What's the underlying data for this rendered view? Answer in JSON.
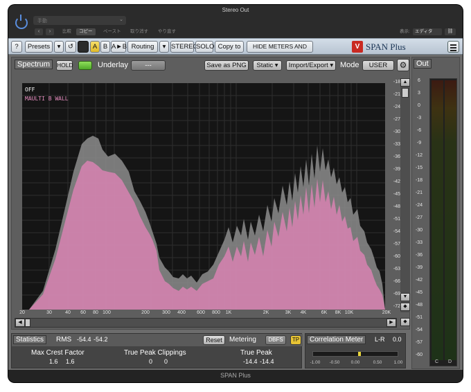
{
  "window": {
    "title": "Stereo Out",
    "footer": "SPAN Plus"
  },
  "host": {
    "preset_value": "手動",
    "buttons": [
      "比較",
      "コピー",
      "ペースト",
      "取り消す",
      "やり直す"
    ],
    "display_label": "表示:",
    "display_value": "エディタ"
  },
  "toolbar": {
    "help": "?",
    "presets": "Presets",
    "a": "A",
    "b": "B",
    "atob": "A►B",
    "routing": "Routing",
    "stereo": "STEREO",
    "solo": "SOLO",
    "copy_to": "Copy to",
    "hide_meters": "HIDE METERS AND STATS",
    "product": "SPAN Plus"
  },
  "spectrum": {
    "title": "Spectrum",
    "hold": "HOLD",
    "underlay_label": "Underlay",
    "underlay_value": "---",
    "save_png": "Save as PNG",
    "static": "Static",
    "import_export": "Import/Export",
    "mode_label": "Mode",
    "mode_value": "USER",
    "legend_off": "OFF",
    "legend_trace": "MAULTI B WALL",
    "db_ticks": [
      "-18",
      "-21",
      "-24",
      "-27",
      "-30",
      "-33",
      "-36",
      "-39",
      "-42",
      "-45",
      "-48",
      "-51",
      "-54",
      "-57",
      "-60",
      "-63",
      "-66",
      "-69",
      "-72"
    ],
    "freq_ticks": [
      "20",
      "30",
      "40",
      "60",
      "80",
      "100",
      "200",
      "300",
      "400",
      "600",
      "800",
      "1K",
      "2K",
      "3K",
      "4K",
      "6K",
      "8K",
      "10K",
      "20K"
    ]
  },
  "statistics": {
    "title": "Statistics",
    "rms_label": "RMS",
    "rms_l": "-54.4",
    "rms_r": "-54.2",
    "reset": "Reset",
    "metering_label": "Metering",
    "dbfs": "DBFS",
    "tp": "TP",
    "crest_label": "Max Crest Factor",
    "crest_l": "1.6",
    "crest_r": "1.6",
    "clip_label": "True Peak Clippings",
    "clip_l": "0",
    "clip_r": "0",
    "peak_label": "True Peak",
    "peak_l": "-14.4",
    "peak_r": "-14.4"
  },
  "correlation": {
    "title": "Correlation Meter",
    "mode": "L-R",
    "value": "0.0",
    "scale": [
      "-1.00",
      "-0.50",
      "0.00",
      "0.50",
      "1.00"
    ]
  },
  "out": {
    "title": "Out",
    "ticks": [
      "6",
      "3",
      "0",
      "-3",
      "-6",
      "-9",
      "-12",
      "-15",
      "-18",
      "-21",
      "-24",
      "-27",
      "-30",
      "-33",
      "-36",
      "-39",
      "-42",
      "-45",
      "-48",
      "-51",
      "-54",
      "-57",
      "-60"
    ],
    "ch_l": "C",
    "ch_r": "D"
  },
  "colors": {
    "accent": "#e78ec0",
    "toolbar": "#c8d2dc",
    "led": "#6cc63a"
  }
}
